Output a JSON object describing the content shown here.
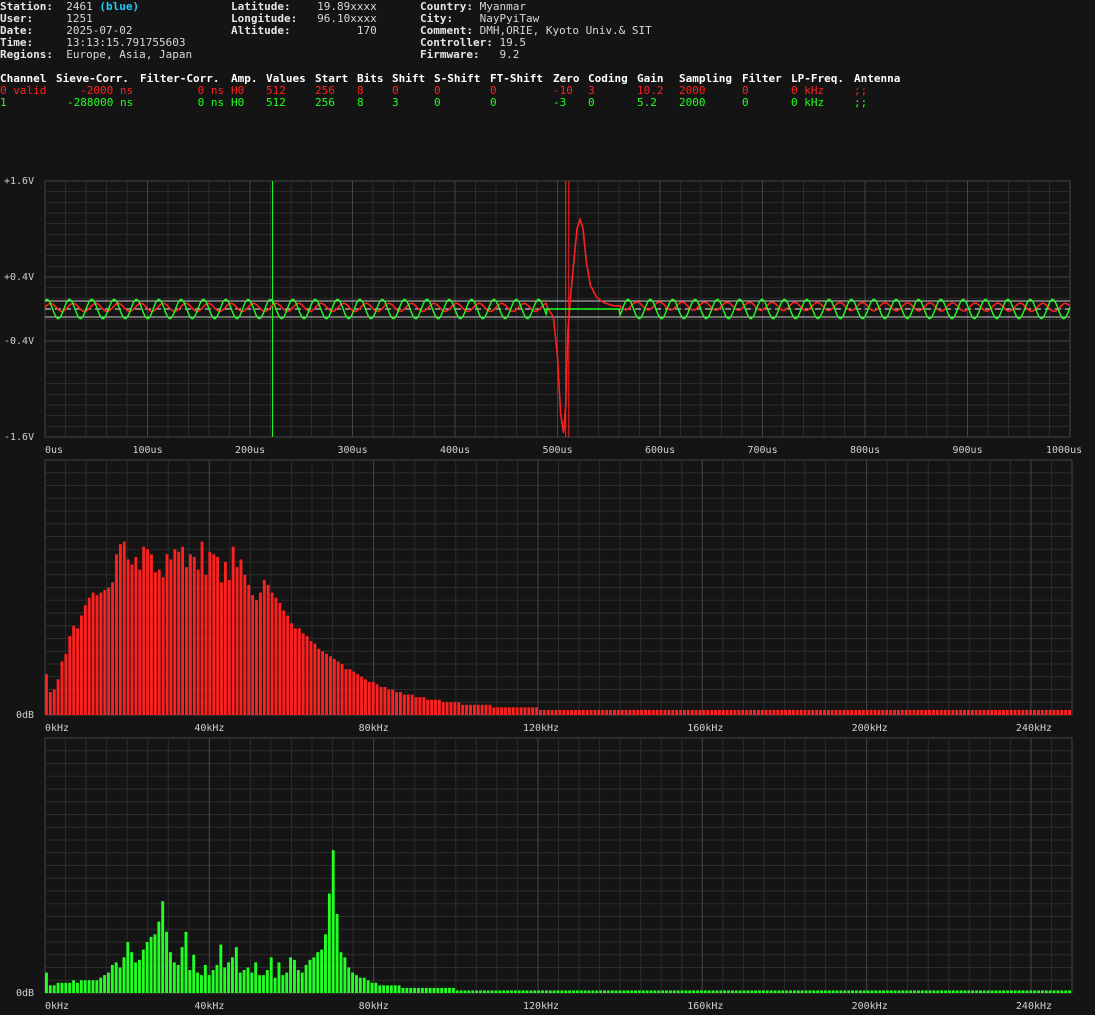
{
  "station": {
    "station_label": "Station:",
    "station_value": "2461",
    "station_color": "(blue)",
    "user_label": "User:",
    "user_value": "1251",
    "date_label": "Date:",
    "date_value": "2025-07-02",
    "time_label": "Time:",
    "time_value": "13:13:15.791755603",
    "regions_label": "Regions:",
    "regions_value": "Europe, Asia, Japan",
    "latitude_label": "Latitude:",
    "latitude_value": "19.89xxxx",
    "longitude_label": "Longitude:",
    "longitude_value": "96.10xxxx",
    "altitude_label": "Altitude:",
    "altitude_value": "170",
    "country_label": "Country:",
    "country_value": "Myanmar",
    "city_label": "City:",
    "city_value": "NayPyiTaw",
    "comment_label": "Comment:",
    "comment_value": "DMH,ORIE, Kyoto Univ.& SIT",
    "controller_label": "Controller:",
    "controller_value": "19.5",
    "firmware_label": "Firmware:",
    "firmware_value": "9.2"
  },
  "channels": {
    "headers": [
      "Channel",
      "Sieve-Corr.",
      "Filter-Corr.",
      "Amp.",
      "Values",
      "Start",
      "Bits",
      "Shift",
      "S-Shift",
      "FT-Shift",
      "Zero",
      "Coding",
      "Gain",
      "Sampling",
      "Filter",
      "LP-Freq.",
      "Antenna"
    ],
    "rows": [
      {
        "color": "#ff2020",
        "cells": [
          "0 valid",
          "-2000 ns",
          "0 ns",
          "H0",
          "512",
          "256",
          "8",
          "0",
          "0",
          "0",
          "-10",
          "3",
          "10.2",
          "2000",
          "0",
          "0 kHz",
          ";;"
        ]
      },
      {
        "color": "#22ff22",
        "cells": [
          "1",
          "-288000 ns",
          "0 ns",
          "H0",
          "512",
          "256",
          "8",
          "3",
          "0",
          "0",
          "-3",
          "0",
          "5.2",
          "2000",
          "0",
          "0 kHz",
          ";;"
        ]
      }
    ]
  },
  "colors": {
    "ch0": "#ff2020",
    "ch1": "#22ff22",
    "grid": "#444444",
    "gridMinor": "#2c2c2c",
    "bg": "#141414"
  },
  "chart_data": [
    {
      "type": "line",
      "y_ticks": [
        "+1.6V",
        "+0.4V",
        "-0.4V",
        "-1.6V"
      ],
      "y_tick_values": [
        1.6,
        0.4,
        -0.4,
        -1.6
      ],
      "x_ticks": [
        "0us",
        "100us",
        "200us",
        "300us",
        "400us",
        "500us",
        "600us",
        "700us",
        "800us",
        "900us",
        "1000us"
      ],
      "xlim": [
        0,
        1000
      ],
      "ylim": [
        -1.6,
        1.6
      ],
      "threshold_levels": [
        0.1,
        -0.1
      ],
      "trigger_markers": [
        {
          "x": 222,
          "color": "#22ff22"
        },
        {
          "x": 508,
          "color": "#ff2020"
        },
        {
          "x": 511,
          "color": "#ff2020"
        }
      ],
      "series": [
        {
          "color": "#ff2020",
          "description_free": true,
          "points": [
            [
              0,
              0.02
            ],
            [
              490,
              0.02
            ],
            [
              496,
              -0.1
            ],
            [
              500,
              -0.6
            ],
            [
              503,
              -1.3
            ],
            [
              506,
              -1.55
            ],
            [
              508,
              -1.2
            ],
            [
              510,
              -0.3
            ],
            [
              513,
              0.2
            ],
            [
              516,
              0.6
            ],
            [
              519,
              1.0
            ],
            [
              522,
              1.12
            ],
            [
              525,
              1.0
            ],
            [
              528,
              0.6
            ],
            [
              532,
              0.3
            ],
            [
              538,
              0.15
            ],
            [
              545,
              0.08
            ],
            [
              555,
              0.04
            ],
            [
              1000,
              0.02
            ]
          ],
          "ripple": {
            "amplitude": 0.05,
            "period_us": 22
          }
        },
        {
          "color": "#22ff22",
          "points": [
            [
              0,
              0
            ],
            [
              1000,
              0
            ]
          ],
          "ripple": {
            "amplitude": 0.12,
            "period_us": 21.8
          }
        }
      ]
    },
    {
      "type": "bar",
      "color": "#ff2020",
      "y_ticks": [
        "0dB"
      ],
      "x_ticks": [
        "0kHz",
        "40kHz",
        "80kHz",
        "120kHz",
        "160kHz",
        "200kHz",
        "240kHz"
      ],
      "xlim": [
        0,
        250
      ],
      "ylim": [
        0,
        100
      ],
      "values": [
        16,
        9,
        10,
        14,
        21,
        24,
        31,
        35,
        34,
        39,
        43,
        46,
        48,
        47,
        48,
        49,
        50,
        52,
        63,
        67,
        68,
        61,
        59,
        62,
        57,
        66,
        65,
        63,
        56,
        57,
        54,
        63,
        61,
        65,
        64,
        66,
        58,
        63,
        62,
        57,
        68,
        55,
        64,
        63,
        62,
        52,
        60,
        53,
        66,
        58,
        61,
        55,
        51,
        47,
        45,
        48,
        53,
        51,
        48,
        46,
        44,
        41,
        39,
        36,
        34,
        34,
        32,
        31,
        29,
        28,
        26,
        25,
        24,
        23,
        22,
        21,
        20,
        18,
        18,
        17,
        16,
        15,
        14,
        13,
        13,
        12,
        11,
        11,
        10,
        10,
        9,
        9,
        8,
        8,
        8,
        7,
        7,
        7,
        6,
        6,
        6,
        6,
        5,
        5,
        5,
        5,
        5,
        4,
        4,
        4,
        4,
        4,
        4,
        4,
        4,
        3,
        3,
        3,
        3,
        3,
        3,
        3,
        3,
        3,
        3,
        3,
        3,
        2,
        2,
        2,
        2,
        2,
        2,
        2,
        2,
        2,
        2,
        2,
        2,
        2,
        2,
        2,
        2,
        2,
        2,
        2,
        2,
        2,
        2,
        2,
        2,
        2,
        2,
        2,
        2,
        2,
        2,
        2,
        2,
        2,
        2,
        2,
        2,
        2,
        2,
        2,
        2,
        2,
        2,
        2,
        2,
        2,
        2,
        2,
        2,
        2,
        2,
        2,
        2,
        2,
        2,
        2,
        2,
        2,
        2,
        2,
        2,
        2,
        2,
        2,
        2,
        2,
        2,
        2,
        2,
        2,
        2,
        2,
        2,
        2,
        2,
        2,
        2,
        2,
        2,
        2,
        2,
        2,
        2,
        2,
        2,
        2,
        2,
        2,
        2,
        2,
        2,
        2,
        2,
        2,
        2,
        2,
        2,
        2,
        2,
        2,
        2,
        2,
        2,
        2,
        2,
        2,
        2,
        2,
        2,
        2,
        2,
        2,
        2,
        2,
        2,
        2,
        2,
        2,
        2,
        2,
        2,
        2,
        2,
        2,
        2,
        2,
        2,
        2,
        2,
        2,
        2,
        2,
        2,
        2,
        2,
        2,
        2,
        2
      ]
    },
    {
      "type": "bar",
      "color": "#22ff22",
      "y_ticks": [
        "0dB"
      ],
      "x_ticks": [
        "0kHz",
        "40kHz",
        "80kHz",
        "120kHz",
        "160kHz",
        "200kHz",
        "240kHz"
      ],
      "xlim": [
        0,
        250
      ],
      "ylim": [
        0,
        100
      ],
      "values": [
        8,
        3,
        3,
        4,
        4,
        4,
        4,
        5,
        4,
        5,
        5,
        5,
        5,
        5,
        6,
        7,
        8,
        11,
        12,
        10,
        14,
        20,
        16,
        12,
        13,
        17,
        20,
        22,
        23,
        28,
        36,
        24,
        16,
        12,
        11,
        18,
        24,
        9,
        15,
        8,
        7,
        11,
        7,
        9,
        11,
        19,
        10,
        12,
        14,
        18,
        8,
        9,
        10,
        8,
        12,
        7,
        7,
        9,
        14,
        6,
        12,
        7,
        8,
        14,
        13,
        9,
        8,
        11,
        13,
        14,
        16,
        17,
        23,
        39,
        56,
        31,
        16,
        14,
        10,
        8,
        7,
        6,
        6,
        5,
        4,
        4,
        3,
        3,
        3,
        3,
        3,
        3,
        2,
        2,
        2,
        2,
        2,
        2,
        2,
        2,
        2,
        2,
        2,
        2,
        2,
        2,
        1,
        1,
        1,
        1,
        1,
        1,
        1,
        1,
        1,
        1,
        1,
        1,
        1,
        1,
        1,
        1,
        1,
        1,
        1,
        1,
        1,
        1,
        1,
        1,
        1,
        1,
        1,
        1,
        1,
        1,
        1,
        1,
        1,
        1,
        1,
        1,
        1,
        1,
        1,
        1,
        1,
        1,
        1,
        1,
        1,
        1,
        1,
        1,
        1,
        1,
        1,
        1,
        1,
        1,
        1,
        1,
        1,
        1,
        1,
        1,
        1,
        1,
        1,
        1,
        1,
        1,
        1,
        1,
        1,
        1,
        1,
        1,
        1,
        1,
        1,
        1,
        1,
        1,
        1,
        1,
        1,
        1,
        1,
        1,
        1,
        1,
        1,
        1,
        1,
        1,
        1,
        1,
        1,
        1,
        1,
        1,
        1,
        1,
        1,
        1,
        1,
        1,
        1,
        1,
        1,
        1,
        1,
        1,
        1,
        1,
        1,
        1,
        1,
        1,
        1,
        1,
        1,
        1,
        1,
        1,
        1,
        1,
        1,
        1,
        1,
        1,
        1,
        1,
        1,
        1,
        1,
        1,
        1,
        1,
        1,
        1,
        1,
        1,
        1,
        1,
        1,
        1,
        1,
        1,
        1,
        1,
        1,
        1,
        1,
        1,
        1,
        1,
        1,
        1,
        1,
        1,
        1,
        1,
        1
      ]
    }
  ]
}
